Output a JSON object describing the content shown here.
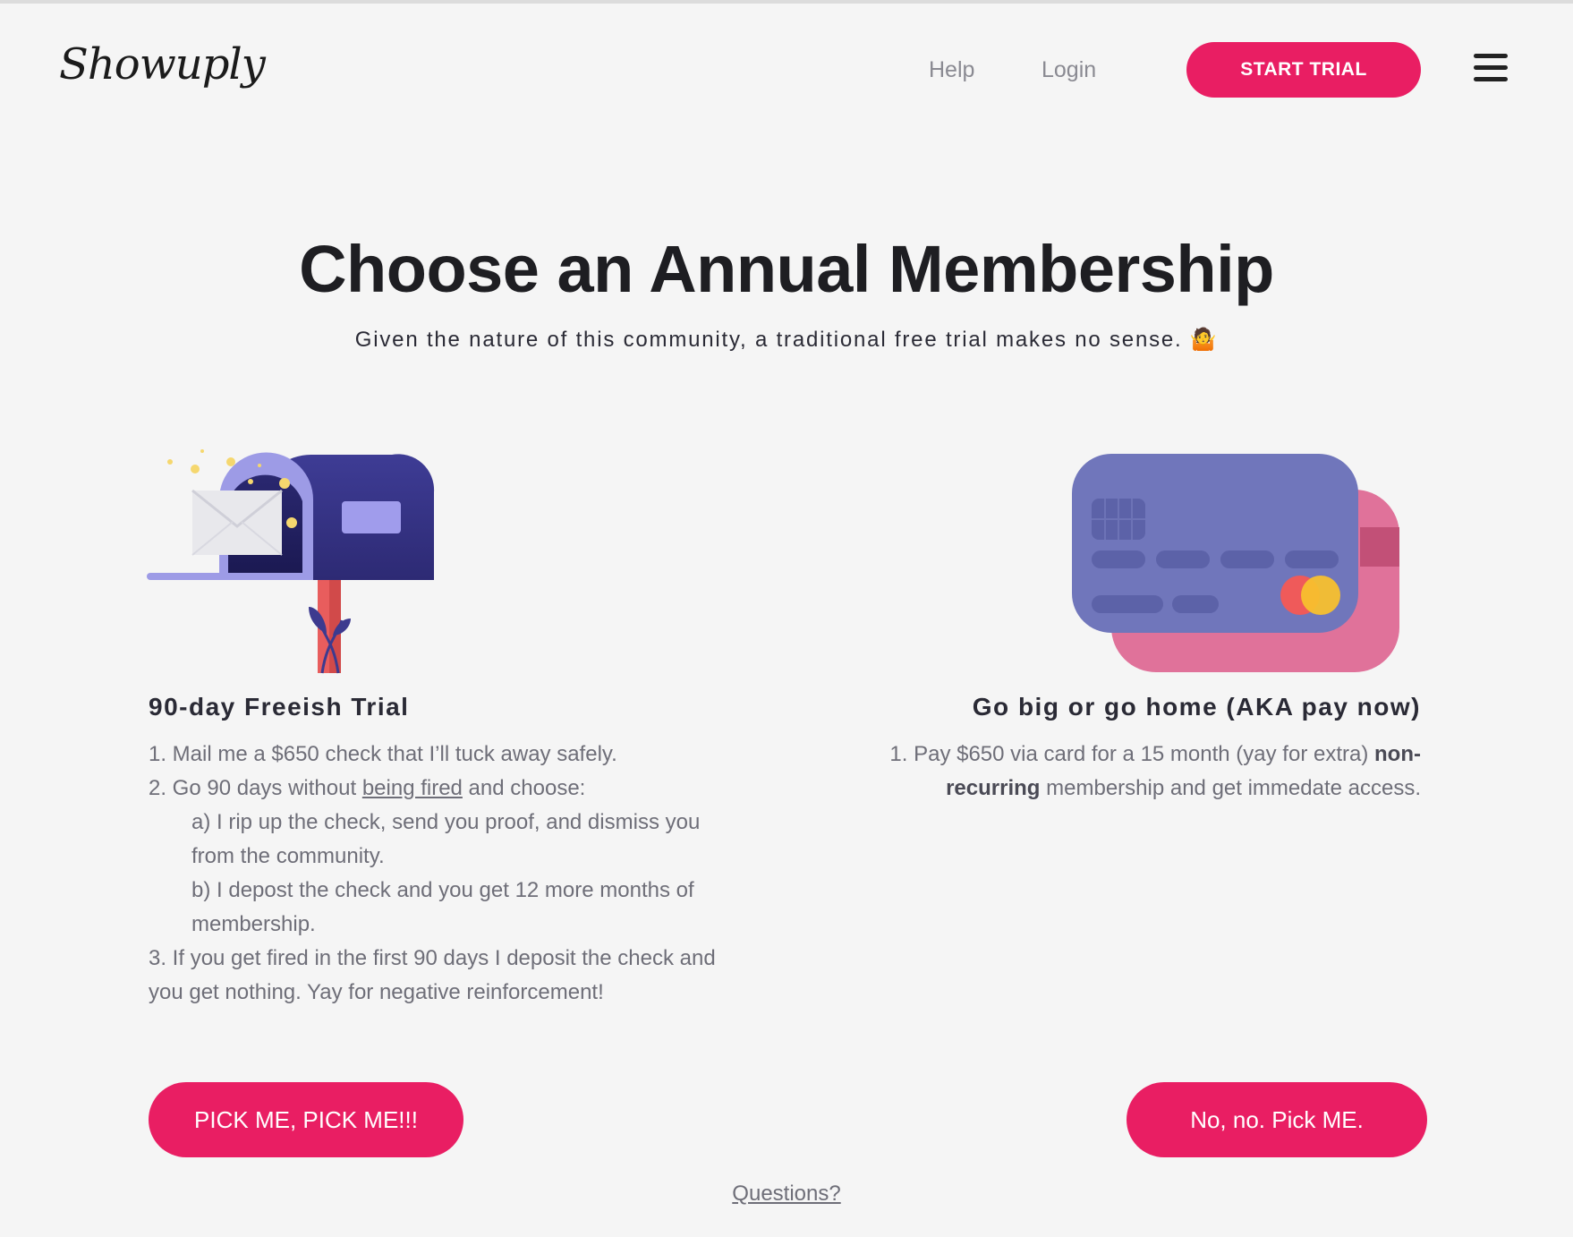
{
  "header": {
    "logo": "Showuply",
    "nav": {
      "help": "Help",
      "login": "Login"
    },
    "start_trial": "START TRIAL"
  },
  "hero": {
    "title": "Choose an Annual Membership",
    "subtitle": "Given the nature of this community, a traditional free trial makes no sense.",
    "emoji": "🤷"
  },
  "plans": {
    "left": {
      "title": "90-day Freeish Trial",
      "step1": "1. Mail me a $650 check that I’ll tuck away safely.",
      "step2_before": "2. Go 90 days without ",
      "step2_link": "being fired",
      "step2_after": " and choose:",
      "option_a": "a) I rip up the check, send you proof, and dismiss you from the community.",
      "option_b": "b) I depost the check and you get 12 more months of membership.",
      "step3": "3. If you get fired in the first 90 days I deposit the check and you get nothing. Yay for negative reinforcement!",
      "button": "PICK ME, PICK ME!!!"
    },
    "right": {
      "title": "Go big or go home (AKA pay now)",
      "step1_before": "1. Pay $650 via card for a 15 month (yay for extra)",
      "step1_bold": "non-recurring",
      "step1_after": " membership and get immedate access.",
      "button": "No, no. Pick ME."
    }
  },
  "footer": {
    "questions": "Questions?"
  },
  "colors": {
    "accent": "#e91e63",
    "background": "#f5f5f5",
    "mailbox": "#3d3a8f",
    "card_front": "#7076bb",
    "card_back": "#e0729a"
  },
  "icons": [
    "mailbox-illustration",
    "credit-card-illustration",
    "hamburger-menu-icon",
    "shrug-emoji"
  ]
}
